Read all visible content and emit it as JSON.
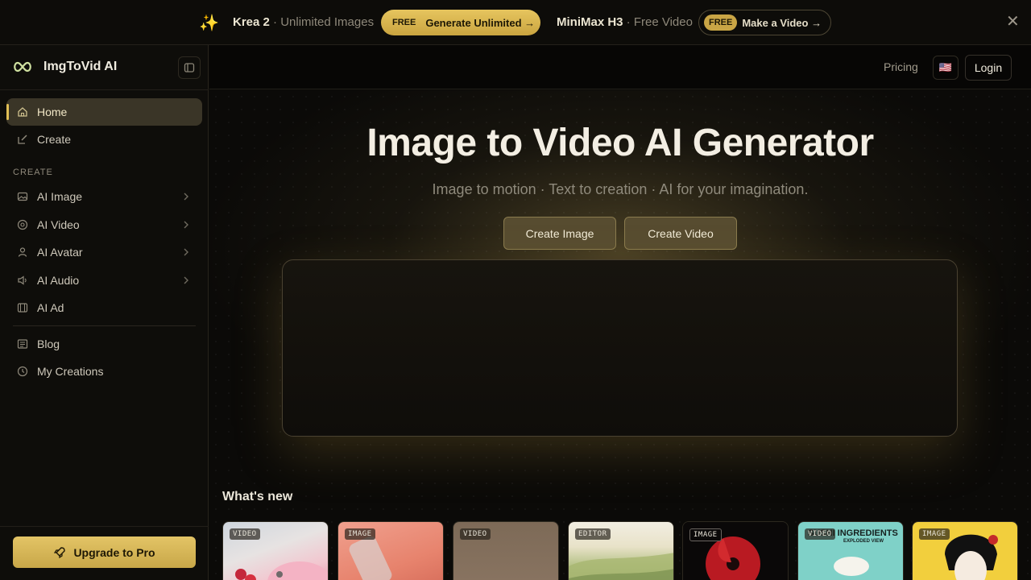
{
  "banner": {
    "krea_title": "Krea 2",
    "krea_sub": " · Unlimited Images",
    "krea_btn_free": "FREE",
    "krea_btn_label": "Generate Unlimited →",
    "minimax_title": "MiniMax H3",
    "minimax_sub": " · Free Video",
    "minimax_btn_free": "FREE",
    "minimax_btn_label": "Make a Video →",
    "close": "✕"
  },
  "sidebar": {
    "brand": "ImgToVid AI",
    "section_label": "CREATE",
    "items": [
      {
        "label": "Home",
        "icon": "home-icon"
      },
      {
        "label": "Create",
        "icon": "edit-icon"
      },
      {
        "label": "AI Image",
        "icon": "image-icon"
      },
      {
        "label": "AI Video",
        "icon": "video-icon"
      },
      {
        "label": "AI Avatar",
        "icon": "user-icon"
      },
      {
        "label": "AI Audio",
        "icon": "speaker-icon"
      },
      {
        "label": "AI Ad",
        "icon": "film-icon"
      },
      {
        "label": "Blog",
        "icon": "newspaper-icon"
      },
      {
        "label": "My Creations",
        "icon": "clock-icon"
      }
    ],
    "upgrade_label": "Upgrade to Pro"
  },
  "header": {
    "pricing": "Pricing",
    "flag": "🇺🇸",
    "login": "Login"
  },
  "hero": {
    "title": "Image to Video AI Generator",
    "subtitle": "Image to motion · Text to creation · AI for your imagination.",
    "create_image": "Create Image",
    "create_video": "Create Video"
  },
  "whats_new": {
    "title": "What's new",
    "cards": [
      {
        "tag": "VIDEO"
      },
      {
        "tag": "IMAGE"
      },
      {
        "tag": "VIDEO"
      },
      {
        "tag": "EDITOR"
      },
      {
        "tag": "IMAGE"
      },
      {
        "tag": "VIDEO"
      },
      {
        "tag": "IMAGE"
      }
    ],
    "sushi_title": "SUSHI INGREDIENTS",
    "sushi_sub": "EXPLODED VIEW"
  },
  "colors": {
    "accent": "#e1bf55",
    "background": "#0b0a08"
  }
}
